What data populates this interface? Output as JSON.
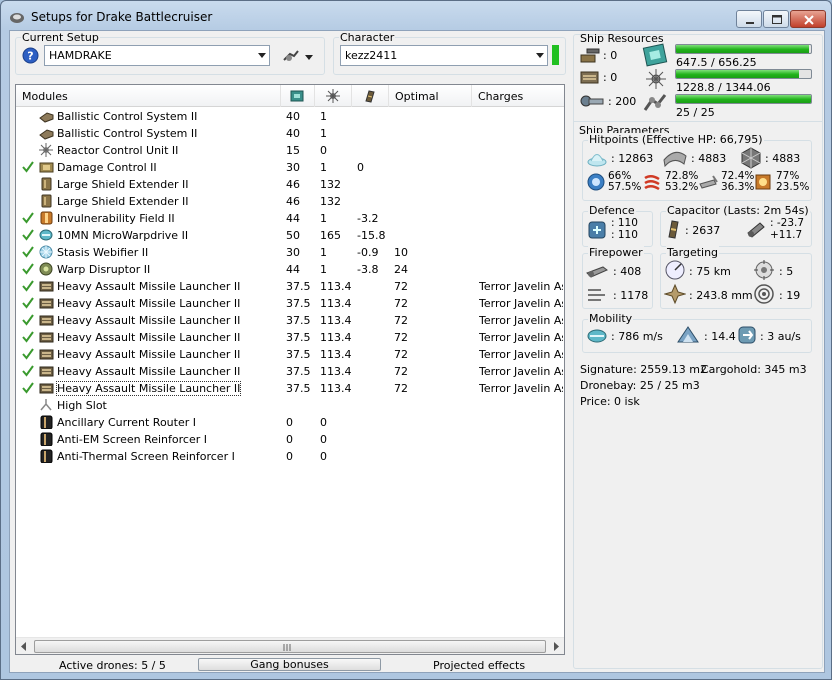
{
  "window": {
    "title": "Setups for Drake Battlecruiser"
  },
  "setup": {
    "label": "Current Setup",
    "value": "HAMDRAKE"
  },
  "character": {
    "label": "Character",
    "value": "kezz2411"
  },
  "grid": {
    "headers": [
      "Modules",
      "",
      "",
      "",
      "Optimal",
      "Charges"
    ],
    "rows": [
      {
        "checked": false,
        "icon": "ballistic-control-icon",
        "name": "Ballistic Control System II",
        "c1": "40",
        "c2": "1",
        "c3": "",
        "c4": "",
        "c5": ""
      },
      {
        "checked": false,
        "icon": "ballistic-control-icon",
        "name": "Ballistic Control System II",
        "c1": "40",
        "c2": "1",
        "c3": "",
        "c4": "",
        "c5": ""
      },
      {
        "checked": false,
        "icon": "reactor-control-icon",
        "name": "Reactor Control Unit II",
        "c1": "15",
        "c2": "0",
        "c3": "",
        "c4": "",
        "c5": ""
      },
      {
        "checked": true,
        "icon": "damage-control-icon",
        "name": "Damage Control II",
        "c1": "30",
        "c2": "1",
        "c3": "0",
        "c4": "",
        "c5": ""
      },
      {
        "checked": false,
        "icon": "shield-extender-icon",
        "name": "Large Shield Extender II",
        "c1": "46",
        "c2": "132",
        "c3": "",
        "c4": "",
        "c5": ""
      },
      {
        "checked": false,
        "icon": "shield-extender-icon",
        "name": "Large Shield Extender II",
        "c1": "46",
        "c2": "132",
        "c3": "",
        "c4": "",
        "c5": ""
      },
      {
        "checked": true,
        "icon": "invulnerability-field-icon",
        "name": "Invulnerability Field II",
        "c1": "44",
        "c2": "1",
        "c3": "-3.2",
        "c4": "",
        "c5": ""
      },
      {
        "checked": true,
        "icon": "microwarpdrive-icon",
        "name": "10MN MicroWarpdrive II",
        "c1": "50",
        "c2": "165",
        "c3": "-15.8",
        "c4": "",
        "c5": ""
      },
      {
        "checked": true,
        "icon": "stasis-webifier-icon",
        "name": "Stasis Webifier II",
        "c1": "30",
        "c2": "1",
        "c3": "-0.9",
        "c4": "10",
        "c5": ""
      },
      {
        "checked": true,
        "icon": "warp-disruptor-icon",
        "name": "Warp Disruptor II",
        "c1": "44",
        "c2": "1",
        "c3": "-3.8",
        "c4": "24",
        "c5": ""
      },
      {
        "checked": true,
        "icon": "missile-launcher-icon",
        "name": "Heavy Assault Missile Launcher II",
        "c1": "37.5",
        "c2": "113.4",
        "c3": "",
        "c4": "72",
        "c5": "Terror Javelin Ass"
      },
      {
        "checked": true,
        "icon": "missile-launcher-icon",
        "name": "Heavy Assault Missile Launcher II",
        "c1": "37.5",
        "c2": "113.4",
        "c3": "",
        "c4": "72",
        "c5": "Terror Javelin Ass"
      },
      {
        "checked": true,
        "icon": "missile-launcher-icon",
        "name": "Heavy Assault Missile Launcher II",
        "c1": "37.5",
        "c2": "113.4",
        "c3": "",
        "c4": "72",
        "c5": "Terror Javelin Ass"
      },
      {
        "checked": true,
        "icon": "missile-launcher-icon",
        "name": "Heavy Assault Missile Launcher II",
        "c1": "37.5",
        "c2": "113.4",
        "c3": "",
        "c4": "72",
        "c5": "Terror Javelin Ass"
      },
      {
        "checked": true,
        "icon": "missile-launcher-icon",
        "name": "Heavy Assault Missile Launcher II",
        "c1": "37.5",
        "c2": "113.4",
        "c3": "",
        "c4": "72",
        "c5": "Terror Javelin Ass"
      },
      {
        "checked": true,
        "icon": "missile-launcher-icon",
        "name": "Heavy Assault Missile Launcher II",
        "c1": "37.5",
        "c2": "113.4",
        "c3": "",
        "c4": "72",
        "c5": "Terror Javelin Ass"
      },
      {
        "checked": true,
        "icon": "missile-launcher-icon",
        "name": "Heavy Assault Missile Launcher II",
        "c1": "37.5",
        "c2": "113.4",
        "c3": "",
        "c4": "72",
        "c5": "Terror Javelin Ass"
      },
      {
        "checked": false,
        "icon": "high-slot-icon",
        "name": "High Slot",
        "c1": "",
        "c2": "",
        "c3": "",
        "c4": "",
        "c5": ""
      },
      {
        "checked": false,
        "icon": "rig-icon",
        "name": "Ancillary Current Router I",
        "c1": "0",
        "c2": "0",
        "c3": "",
        "c4": "",
        "c5": ""
      },
      {
        "checked": false,
        "icon": "rig-icon",
        "name": "Anti-EM Screen Reinforcer I",
        "c1": "0",
        "c2": "0",
        "c3": "",
        "c4": "",
        "c5": ""
      },
      {
        "checked": false,
        "icon": "rig-icon",
        "name": "Anti-Thermal Screen Reinforcer I",
        "c1": "0",
        "c2": "0",
        "c3": "",
        "c4": "",
        "c5": ""
      }
    ]
  },
  "status": {
    "drones": "Active drones: 5 / 5",
    "gang": "Gang bonuses",
    "projected": "Projected effects"
  },
  "resources": {
    "label": "Ship Resources",
    "turrets": ": 0",
    "launchers": ": 0",
    "drone_bw": ": 200",
    "cpu": "647.5 / 656.25",
    "cpu_fraction": 0.987,
    "powergrid": "1228.8 / 1344.06",
    "powergrid_fraction": 0.914,
    "calibration": "25 / 25",
    "calibration_fraction": 1.0
  },
  "params": {
    "label": "Ship Parameters",
    "hitpoints_label": "Hitpoints (Effective HP: 66,795)",
    "hp_shield": ": 12863",
    "hp_armor": ": 4883",
    "hp_structure": ": 4883",
    "res_shield_em": "66%",
    "res_armor_em": "57.5%",
    "res_shield_th": "72.8%",
    "res_armor_th": "53.2%",
    "res_shield_ki": "72.4%",
    "res_armor_ki": "36.3%",
    "res_shield_ex": "77%",
    "res_armor_ex": "23.5%",
    "defence_label": "Defence",
    "def_1": ": 110",
    "def_2": ": 110",
    "capacitor_label": "Capacitor (Lasts: 2m 54s)",
    "cap_amount": ": 2637",
    "cap_use": ": -23.7",
    "cap_regen": "+11.7",
    "firepower_label": "Firepower",
    "dps": ": 408",
    "volley": ": 1178",
    "targeting_label": "Targeting",
    "range": ": 75 km",
    "max_targets": ": 5",
    "scan_res": ": 243.8 mm",
    "sensor": ": 19",
    "mobility_label": "Mobility",
    "speed": ": 786 m/s",
    "align": ": 14.4 s",
    "warp": ": 3 au/s",
    "signature": "Signature: 2559.13 m2",
    "cargohold": "Cargohold: 345 m3",
    "dronebay": "Dronebay: 25 / 25 m3",
    "price": "Price: 0 isk"
  },
  "colors": {
    "accent_green": "#21b31b",
    "check_green": "#3a9a2e"
  }
}
